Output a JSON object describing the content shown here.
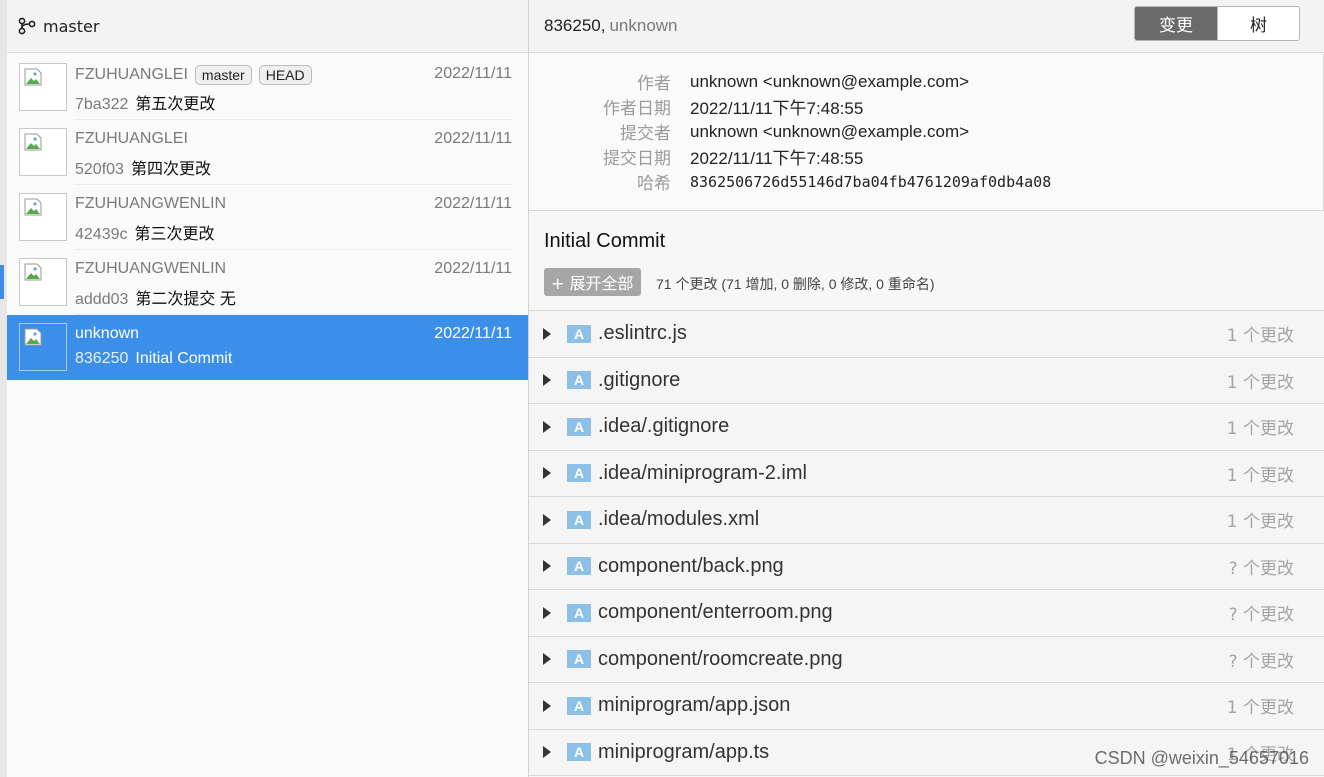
{
  "branch": {
    "name": "master",
    "icon": "branch-icon"
  },
  "commits": [
    {
      "author": "FZUHUANGLEI",
      "date": "2022/11/11",
      "hash": "7ba322",
      "message": "第五次更改",
      "tags": [
        "master",
        "HEAD"
      ]
    },
    {
      "author": "FZUHUANGLEI",
      "date": "2022/11/11",
      "hash": "520f03",
      "message": "第四次更改",
      "tags": []
    },
    {
      "author": "FZUHUANGWENLIN",
      "date": "2022/11/11",
      "hash": "42439c",
      "message": "第三次更改",
      "tags": []
    },
    {
      "author": "FZUHUANGWENLIN",
      "date": "2022/11/11",
      "hash": "addd03",
      "message": "第二次提交 无",
      "tags": []
    },
    {
      "author": "unknown",
      "date": "2022/11/11",
      "hash": "836250",
      "message": "Initial Commit",
      "tags": [],
      "selected": true
    }
  ],
  "detail": {
    "header_hash": "836250,",
    "header_author": "unknown",
    "view_toggle": {
      "changes_label": "变更",
      "tree_label": "树",
      "active": "changes"
    },
    "meta": {
      "author_label": "作者",
      "author_value": "unknown <unknown@example.com>",
      "author_date_label": "作者日期",
      "author_date_value": "2022/11/11下午7:48:55",
      "committer_label": "提交者",
      "committer_value": "unknown <unknown@example.com>",
      "commit_date_label": "提交日期",
      "commit_date_value": "2022/11/11下午7:48:55",
      "hash_label": "哈希",
      "hash_value": "8362506726d55146d7ba04fb4761209af0db4a08"
    },
    "title": "Initial Commit",
    "expand_all_label": "+ 展开全部",
    "change_summary": "71 个更改 (71 增加, 0 删除, 0 修改, 0 重命名)",
    "files": [
      {
        "status": "A",
        "path": ".eslintrc.js",
        "changes": "1 个更改"
      },
      {
        "status": "A",
        "path": ".gitignore",
        "changes": "1 个更改"
      },
      {
        "status": "A",
        "path": ".idea/.gitignore",
        "changes": "1 个更改"
      },
      {
        "status": "A",
        "path": ".idea/miniprogram-2.iml",
        "changes": "1 个更改"
      },
      {
        "status": "A",
        "path": ".idea/modules.xml",
        "changes": "1 个更改"
      },
      {
        "status": "A",
        "path": "component/back.png",
        "changes": "? 个更改"
      },
      {
        "status": "A",
        "path": "component/enterroom.png",
        "changes": "? 个更改"
      },
      {
        "status": "A",
        "path": "component/roomcreate.png",
        "changes": "? 个更改"
      },
      {
        "status": "A",
        "path": "miniprogram/app.json",
        "changes": "1 个更改"
      },
      {
        "status": "A",
        "path": "miniprogram/app.ts",
        "changes": "1 个更改"
      }
    ]
  },
  "watermark": "CSDN @weixin_54657016",
  "colors": {
    "selection": "#3c8fe8",
    "status_added": "#8dc0e6",
    "toggle_active": "#6b6b6b"
  }
}
